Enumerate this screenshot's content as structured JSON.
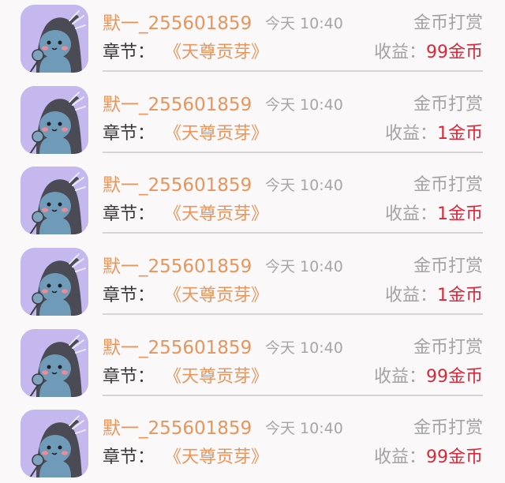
{
  "colors": {
    "username": "#e8955c",
    "chapter_title": "#e8955c",
    "income_value": "#d8283a",
    "muted": "#a3a3a3",
    "avatar_bg": "#c4b8ef"
  },
  "records": [
    {
      "avatar_icon": "user-avatar-icon",
      "username": "默一_255601859",
      "time": "今天 10:40",
      "type": "金币打赏",
      "chapter_label": "章节：",
      "chapter_title": "《天尊贡芽》",
      "income_label": "收益：",
      "income_value": "99金币"
    },
    {
      "avatar_icon": "user-avatar-icon",
      "username": "默一_255601859",
      "time": "今天 10:40",
      "type": "金币打赏",
      "chapter_label": "章节：",
      "chapter_title": "《天尊贡芽》",
      "income_label": "收益：",
      "income_value": "1金币"
    },
    {
      "avatar_icon": "user-avatar-icon",
      "username": "默一_255601859",
      "time": "今天 10:40",
      "type": "金币打赏",
      "chapter_label": "章节：",
      "chapter_title": "《天尊贡芽》",
      "income_label": "收益：",
      "income_value": "1金币"
    },
    {
      "avatar_icon": "user-avatar-icon",
      "username": "默一_255601859",
      "time": "今天 10:40",
      "type": "金币打赏",
      "chapter_label": "章节：",
      "chapter_title": "《天尊贡芽》",
      "income_label": "收益：",
      "income_value": "1金币"
    },
    {
      "avatar_icon": "user-avatar-icon",
      "username": "默一_255601859",
      "time": "今天 10:40",
      "type": "金币打赏",
      "chapter_label": "章节：",
      "chapter_title": "《天尊贡芽》",
      "income_label": "收益：",
      "income_value": "99金币"
    },
    {
      "avatar_icon": "user-avatar-icon",
      "username": "默一_255601859",
      "time": "今天 10:40",
      "type": "金币打赏",
      "chapter_label": "章节：",
      "chapter_title": "《天尊贡芽》",
      "income_label": "收益：",
      "income_value": "99金币"
    }
  ]
}
